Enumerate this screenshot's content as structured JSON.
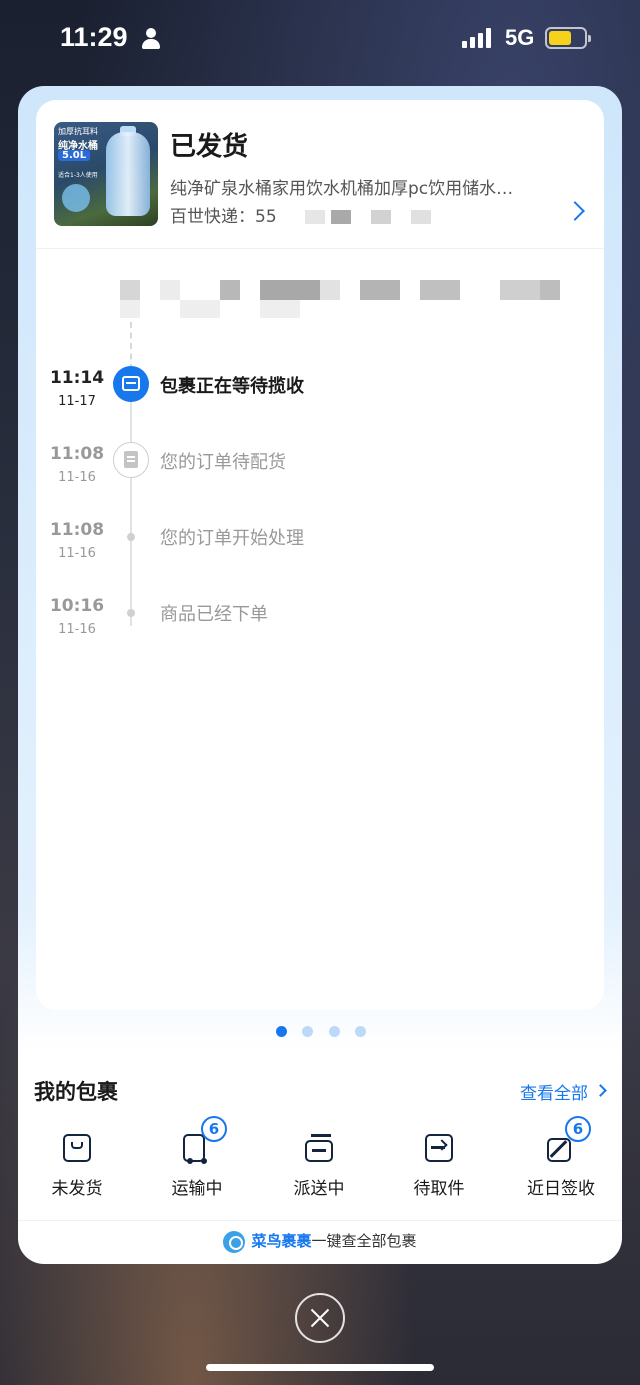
{
  "status_bar": {
    "time": "11:29",
    "network": "5G",
    "battery_color": "#f7d21c"
  },
  "order": {
    "status": "已发货",
    "product_name": "纯净矿泉水桶家用饮水机桶加厚pc饮用储水…",
    "courier_label": "百世快递：55",
    "thumbnail": {
      "line1": "加厚抗耳料",
      "line2": "纯净水桶",
      "line3": "5.0L",
      "line4": "适合1-3人使用"
    }
  },
  "timeline": [
    {
      "time": "11:14",
      "date": "11-17",
      "text": "包裹正在等待揽收",
      "active": true,
      "icon": "package-pickup-icon"
    },
    {
      "time": "11:08",
      "date": "11-16",
      "text": "您的订单待配货",
      "active": false,
      "icon": "document-icon"
    },
    {
      "time": "11:08",
      "date": "11-16",
      "text": "您的订单开始处理",
      "active": false,
      "icon": "dot"
    },
    {
      "time": "10:16",
      "date": "11-16",
      "text": "商品已经下单",
      "active": false,
      "icon": "dot"
    }
  ],
  "pager": {
    "count": 4,
    "active_index": 0
  },
  "my_packages": {
    "title": "我的包裹",
    "see_all": "查看全部",
    "categories": [
      {
        "label": "未发货",
        "badge": null,
        "icon": "unshipped-box-icon"
      },
      {
        "label": "运输中",
        "badge": "6",
        "icon": "truck-icon"
      },
      {
        "label": "派送中",
        "badge": null,
        "icon": "delivery-icon"
      },
      {
        "label": "待取件",
        "badge": null,
        "icon": "pickup-icon"
      },
      {
        "label": "近日签收",
        "badge": "6",
        "icon": "signed-icon"
      }
    ]
  },
  "footer": {
    "brand": "菜鸟裹裹",
    "text": "一键查全部包裹"
  },
  "colors": {
    "accent": "#1778ee",
    "inactive_text": "#999999"
  }
}
